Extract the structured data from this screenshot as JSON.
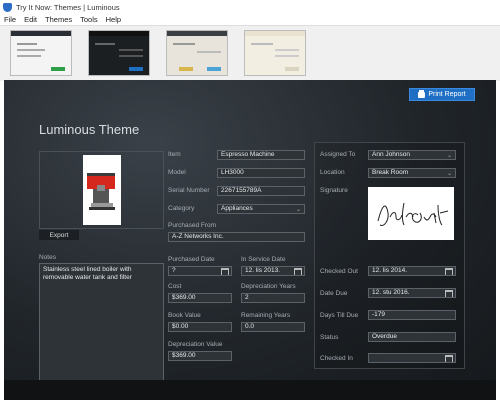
{
  "window": {
    "title": "Try It Now: Themes | Luminous"
  },
  "menu": [
    "File",
    "Edit",
    "Themes",
    "Tools",
    "Help"
  ],
  "themes": [
    "Office",
    "Dark",
    "Light",
    "Luminous"
  ],
  "toolbar": {
    "print_label": "Print Report"
  },
  "page": {
    "heading": "Luminous Theme"
  },
  "left": {
    "export_label": "Export",
    "notes_label": "Notes",
    "notes_value": "Stainless steel lined boiler with removable water tank and filter"
  },
  "fields": {
    "item_label": "Item",
    "item_value": "Espresso Machine",
    "model_label": "Model",
    "model_value": "LH3000",
    "serial_label": "Serial Number",
    "serial_value": "2267155789A",
    "category_label": "Category",
    "category_value": "Appliances",
    "purchased_from_label": "Purchased From",
    "purchased_from_value": "A-Z Networks Inc.",
    "purchased_date_label": "Purchased Date",
    "purchased_date_value": "?",
    "in_service_label": "In Service Date",
    "in_service_value": "12. lis 2013.",
    "cost_label": "Cost",
    "cost_value": "$369.00",
    "dep_years_label": "Depreciation Years",
    "dep_years_value": "2",
    "book_value_label": "Book Value",
    "book_value_value": "$0.00",
    "remaining_years_label": "Remaining Years",
    "remaining_years_value": "0.0",
    "dep_value_label": "Depreciation Value",
    "dep_value_value": "$369.00"
  },
  "right": {
    "assigned_label": "Assigned To",
    "assigned_value": "Ann Johnson",
    "location_label": "Location",
    "location_value": "Break Room",
    "signature_label": "Signature",
    "checked_out_label": "Checked Out",
    "checked_out_value": "12. lis 2014.",
    "date_due_label": "Date Due",
    "date_due_value": "12. stu 2016.",
    "days_till_due_label": "Days Till Due",
    "days_till_due_value": "-179",
    "status_label": "Status",
    "status_value": "Overdue",
    "checked_in_label": "Checked In",
    "checked_in_value": ""
  }
}
